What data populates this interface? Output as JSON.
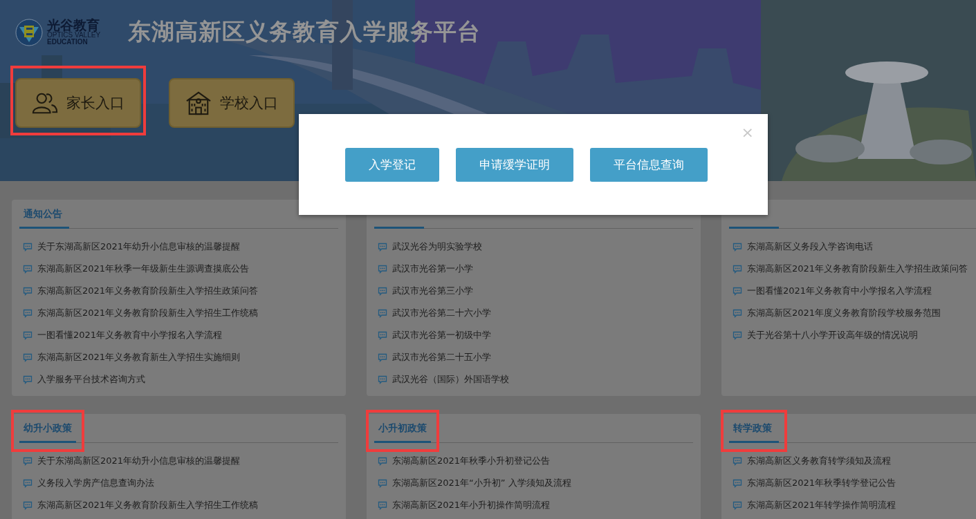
{
  "header": {
    "logo": {
      "name": "光谷教育",
      "english_1": "OPTICS VALLEY",
      "english_2": "EDUCATION"
    },
    "title": "东湖高新区义务教育入学服务平台",
    "entries": [
      {
        "label": "家长入口",
        "kind": "parent",
        "highlighted": true
      },
      {
        "label": "学校入口",
        "kind": "school",
        "highlighted": false
      }
    ]
  },
  "modal": {
    "close": "×",
    "buttons": [
      "入学登记",
      "申请缓学证明",
      "平台信息查询"
    ]
  },
  "cards": [
    {
      "highlighted": false,
      "items": [
        "关于东湖高新区2021年幼升小信息审核的温馨提醒",
        "东湖高新区2021年秋季一年级新生生源调查摸底公告",
        "东湖高新区2021年义务教育阶段新生入学招生政策问答",
        "东湖高新区2021年义务教育阶段新生入学招生工作统稿",
        "一图看懂2021年义务教育中小学报名入学流程",
        "东湖高新区2021年义务教育新生入学招生实施细则",
        "入学服务平台技术咨询方式"
      ],
      "title": "通知公告"
    },
    {
      "highlighted": false,
      "items": [
        "武汉光谷为明实验学校",
        "武汉市光谷第一小学",
        "武汉市光谷第三小学",
        "武汉市光谷第二十六小学",
        "武汉市光谷第一初级中学",
        "武汉市光谷第二十五小学",
        "武汉光谷（国际）外国语学校"
      ]
    },
    {
      "highlighted": false,
      "items": [
        "东湖高新区义务段入学咨询电话",
        "东湖高新区2021年义务教育阶段新生入学招生政策问答",
        "一图看懂2021年义务教育中小学报名入学流程",
        "东湖高新区2021年度义务教育阶段学校服务范围",
        "关于光谷第十八小学开设高年级的情况说明"
      ]
    },
    {
      "highlighted": true,
      "title": "幼升小政策",
      "items": [
        "关于东湖高新区2021年幼升小信息审核的温馨提醒",
        "义务段入学房产信息查询办法",
        "东湖高新区2021年义务教育阶段新生入学招生工作统稿"
      ]
    },
    {
      "highlighted": true,
      "title": "小升初政策",
      "items": [
        "东湖高新区2021年秋季小升初登记公告",
        "东湖高新区2021年“小升初” 入学须知及流程",
        "东湖高新区2021年小升初操作简明流程"
      ]
    },
    {
      "highlighted": true,
      "title": "转学政策",
      "items": [
        "东湖高新区义务教育转学须知及流程",
        "东湖高新区2021年秋季转学登记公告",
        "东湖高新区2021年转学操作简明流程"
      ]
    }
  ]
}
